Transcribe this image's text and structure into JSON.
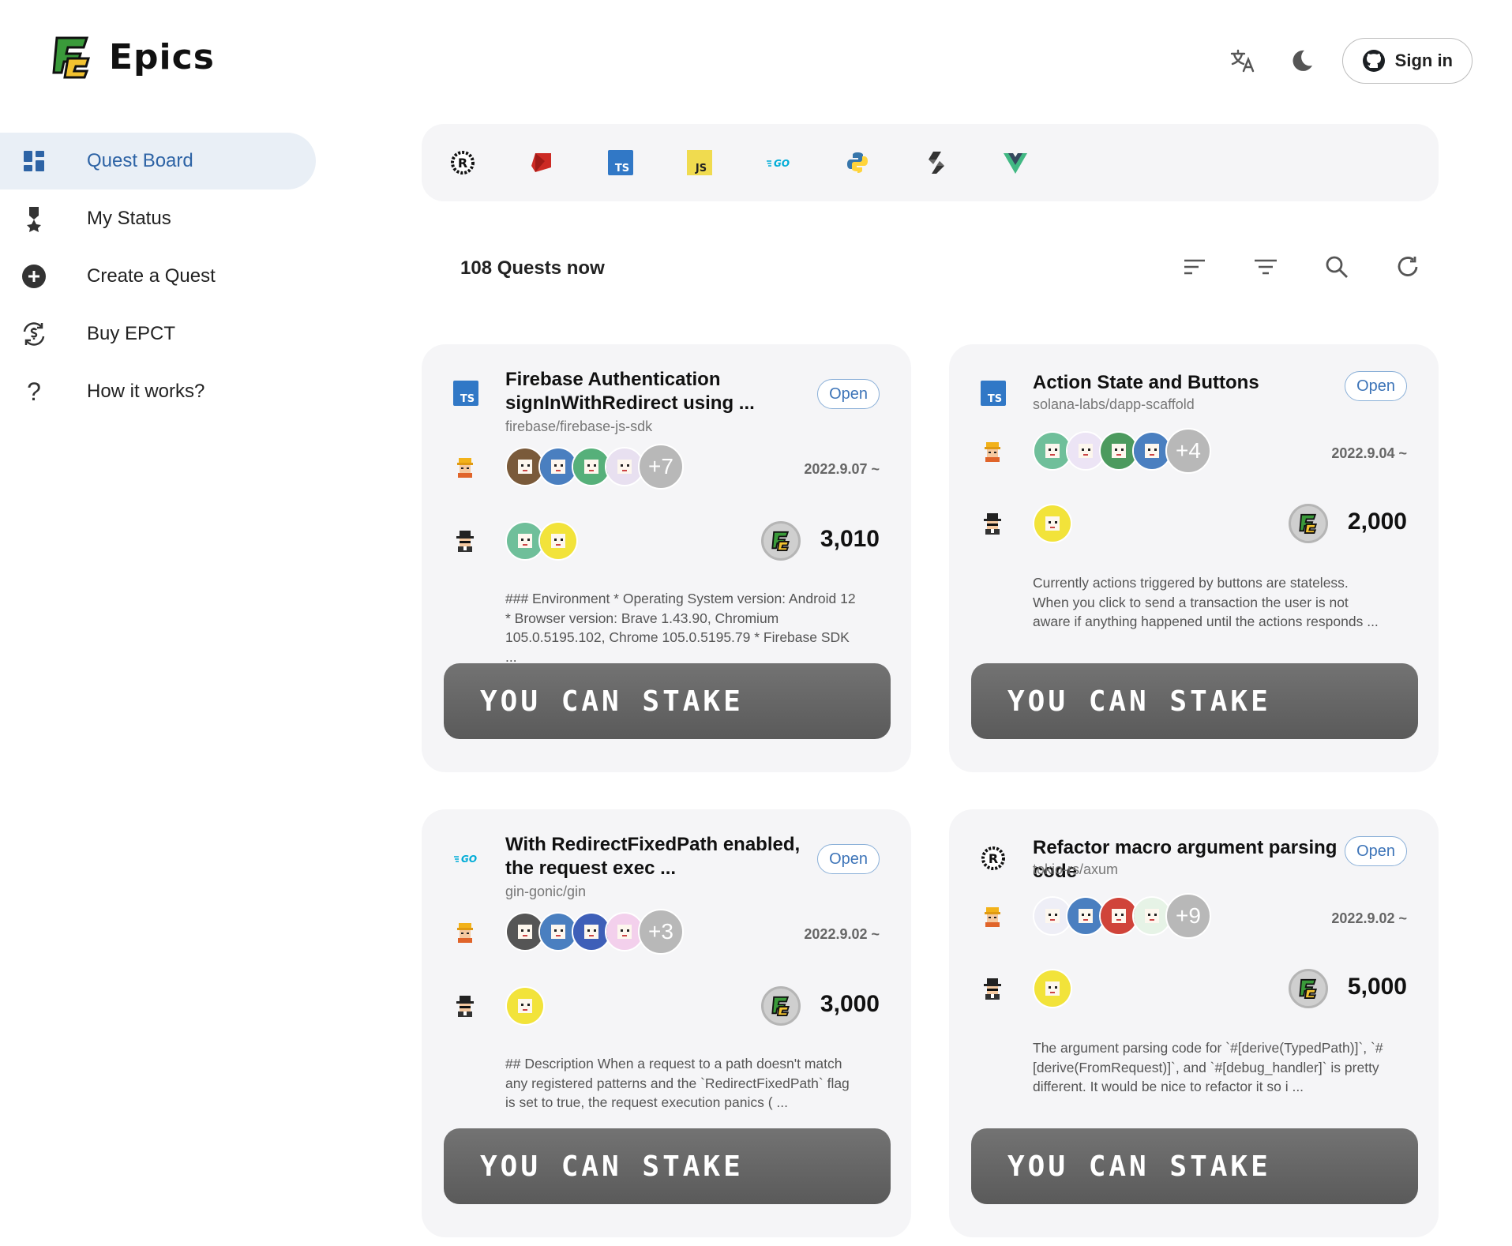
{
  "app": {
    "name": "Epics"
  },
  "header": {
    "signin_label": "Sign in",
    "icons": [
      "translate-icon",
      "moon-icon",
      "github-icon"
    ]
  },
  "sidebar": {
    "items": [
      {
        "label": "Quest Board",
        "icon": "dashboard-icon",
        "active": true
      },
      {
        "label": "My Status",
        "icon": "medal-icon"
      },
      {
        "label": "Create a Quest",
        "icon": "plus-circle-icon"
      },
      {
        "label": "Buy EPCT",
        "icon": "dollar-exchange-icon"
      },
      {
        "label": "How it works?",
        "icon": "question-icon"
      }
    ]
  },
  "languages": [
    {
      "name": "rust",
      "icon": "rust-icon"
    },
    {
      "name": "ruby",
      "icon": "ruby-icon"
    },
    {
      "name": "typescript",
      "label": "TS",
      "color": "#3178c6"
    },
    {
      "name": "javascript",
      "label": "JS",
      "color": "#f0db4f"
    },
    {
      "name": "go",
      "label": "GO",
      "color": "#00acd7"
    },
    {
      "name": "python",
      "icon": "python-icon"
    },
    {
      "name": "solidity",
      "icon": "solidity-icon"
    },
    {
      "name": "vue",
      "icon": "vue-icon",
      "color": "#41b883"
    }
  ],
  "board": {
    "count_text": "108 Quests now",
    "tools": [
      "sort-icon",
      "filter-icon",
      "search-icon",
      "refresh-icon"
    ]
  },
  "cards": [
    {
      "lang": "TS",
      "title": "Firebase Authentication signInWithRedirect using ...",
      "repo": "firebase/firebase-js-sdk",
      "status": "Open",
      "more": "+7",
      "date": "2022.9.07 ~",
      "amount": "3,010",
      "description": "### Environment * Operating System version: Android 12 * Browser version: Brave 1.43.90, Chromium 105.0.5195.102, Chrome 105.0.5195.79 * Firebase SDK ...",
      "stake_label": "YOU CAN STAKE"
    },
    {
      "lang": "TS",
      "title": "Action State and Buttons",
      "repo": "solana-labs/dapp-scaffold",
      "status": "Open",
      "more": "+4",
      "date": "2022.9.04 ~",
      "amount": "2,000",
      "description": "Currently actions triggered by buttons are stateless. When you click to send a transaction the user is not aware if anything happened until the actions responds ...",
      "stake_label": "YOU CAN STAKE"
    },
    {
      "lang": "GO",
      "title": "With RedirectFixedPath enabled, the request exec ...",
      "repo": "gin-gonic/gin",
      "status": "Open",
      "more": "+3",
      "date": "2022.9.02 ~",
      "amount": "3,000",
      "description": "## Description When a request to a path doesn't match any registered patterns and the `RedirectFixedPath` flag is set to true, the request execution panics ( ...",
      "stake_label": "YOU CAN STAKE"
    },
    {
      "lang": "R",
      "title": "Refactor macro argument parsing code",
      "repo": "tokio-rs/axum",
      "status": "Open",
      "more": "+9",
      "date": "2022.9.02 ~",
      "amount": "5,000",
      "description": "The argument parsing code for `#[derive(TypedPath)]`, `#[derive(FromRequest)]`, and `#[debug_handler]` is pretty different. It would be nice to refactor it so i ...",
      "stake_label": "YOU CAN STAKE"
    }
  ]
}
